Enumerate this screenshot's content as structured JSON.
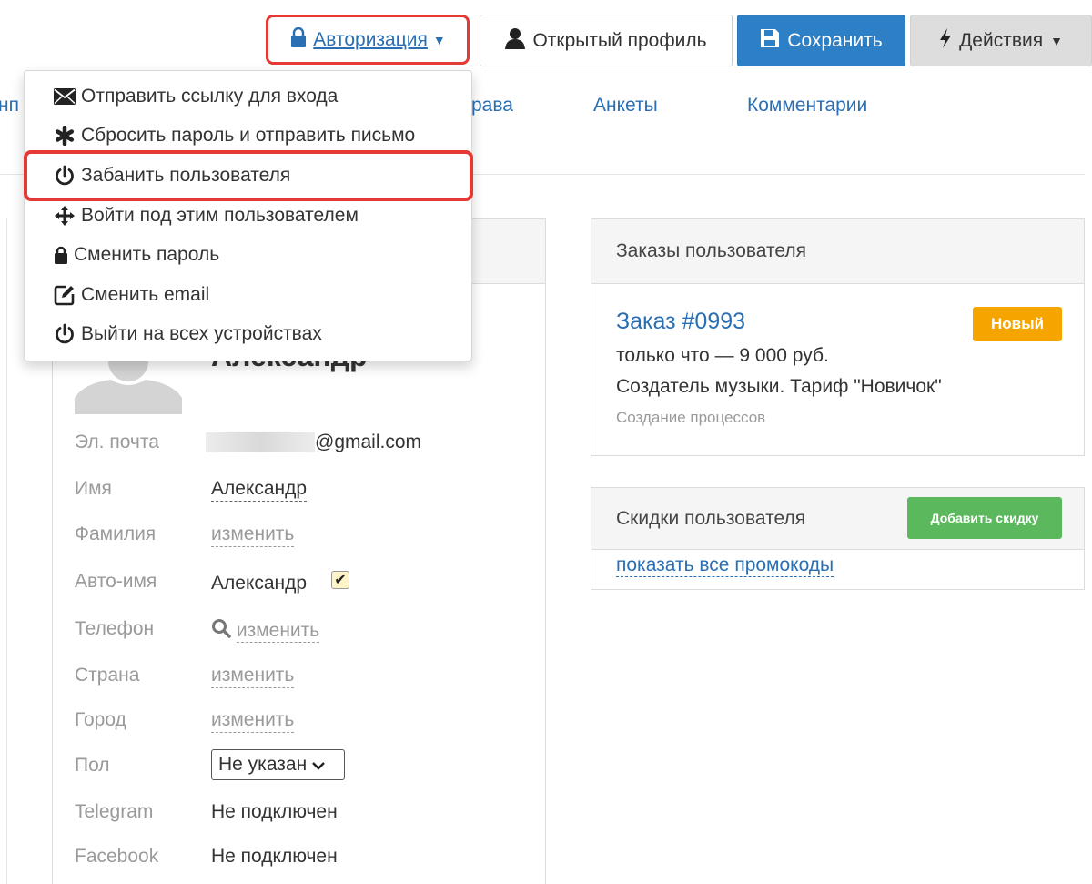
{
  "toolbar": {
    "auth_label": "Авторизация",
    "profile_label": "Открытый профиль",
    "save_label": "Сохранить",
    "actions_label": "Действия"
  },
  "tabs": [
    {
      "label": "нп"
    },
    {
      "label": "рава"
    },
    {
      "label": "Анкеты"
    },
    {
      "label": "Комментарии"
    }
  ],
  "auth_menu": {
    "items": [
      {
        "label": "Отправить ссылку для входа",
        "icon": "envelope-icon"
      },
      {
        "label": "Сбросить пароль и отправить письмо",
        "icon": "asterisk-icon"
      },
      {
        "label": "Забанить пользователя",
        "icon": "power-icon"
      },
      {
        "label": "Войти под этим пользователем",
        "icon": "move-icon"
      },
      {
        "label": "Сменить пароль",
        "icon": "lock-icon"
      },
      {
        "label": "Сменить email",
        "icon": "edit-icon"
      },
      {
        "label": "Выйти на всех устройствах",
        "icon": "power-icon"
      }
    ],
    "highlight_color": "#e53935"
  },
  "profile": {
    "name": "Александр",
    "fields": [
      {
        "label": "Эл. почта",
        "value": "@gmail.com"
      },
      {
        "label": "Имя",
        "value": "Александр"
      },
      {
        "label": "Фамилия",
        "value": "изменить"
      },
      {
        "label": "Авто-имя",
        "value": "Александр",
        "checked": true
      },
      {
        "label": "Телефон",
        "value": "изменить"
      },
      {
        "label": "Страна",
        "value": "изменить"
      },
      {
        "label": "Город",
        "value": "изменить"
      },
      {
        "label": "Пол",
        "value": "Не указан"
      },
      {
        "label": "Telegram",
        "value": "Не подключен"
      },
      {
        "label": "Facebook",
        "value": "Не подключен"
      }
    ]
  },
  "orders": {
    "title": "Заказы пользователя",
    "order_id": "Заказ #0993",
    "status": "Новый",
    "time_price": "только что — 9 000 руб.",
    "product": "Создатель музыки. Тариф \"Новичок\"",
    "process": "Создание процессов"
  },
  "discounts": {
    "title": "Скидки пользователя",
    "add_label": "Добавить скидку",
    "show_all_label": "показать все промокоды"
  },
  "colors": {
    "link": "#2a6fb4",
    "primary": "#2d7fc6",
    "warning": "#f5a400",
    "success": "#5cb85c",
    "annotation": "#e53935"
  }
}
